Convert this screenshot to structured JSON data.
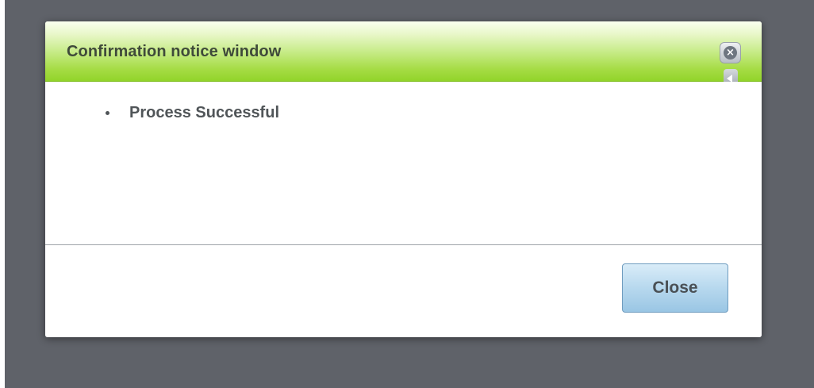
{
  "dialog": {
    "title": "Confirmation notice window",
    "messages": [
      "Process Successful"
    ],
    "close_button_label": "Close",
    "icons": {
      "close": "close-icon",
      "collapse": "collapse-icon"
    }
  },
  "colors": {
    "overlay": "#5f6269",
    "titlebar_top": "#fafff0",
    "titlebar_bottom": "#92d42a",
    "title_text": "#3f4a3a",
    "button_top": "#d9ecf8",
    "button_bottom": "#9ac6e4"
  }
}
